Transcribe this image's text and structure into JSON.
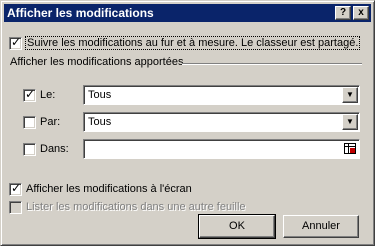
{
  "window": {
    "title": "Afficher les modifications",
    "help_label": "?",
    "close_label": "x"
  },
  "track_changes": {
    "label": "Suivre les modifications au fur et à mesure. Le classeur est partagé.",
    "checked": true
  },
  "group": {
    "title": "Afficher les modifications apportées",
    "when": {
      "label": "Le:",
      "checked": true,
      "value": "Tous"
    },
    "who": {
      "label": "Par:",
      "checked": false,
      "value": "Tous"
    },
    "where": {
      "label": "Dans:",
      "checked": false,
      "value": ""
    }
  },
  "highlight_on_screen": {
    "label": "Afficher les modifications à l'écran",
    "checked": true
  },
  "list_on_sheet": {
    "label": "Lister les modifications dans une autre feuille",
    "checked": false,
    "enabled": false
  },
  "buttons": {
    "ok": "OK",
    "cancel": "Annuler"
  },
  "icons": {
    "dropdown": "chevron-down-icon",
    "range_picker": "range-selector-icon"
  },
  "colors": {
    "titlebar": "#0a246a",
    "face": "#d4d0c8"
  }
}
